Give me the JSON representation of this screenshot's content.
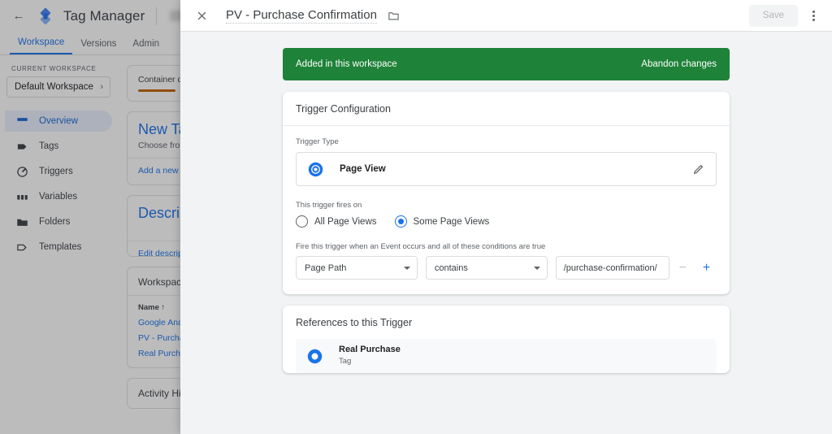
{
  "background": {
    "back_icon": "back-arrow-icon",
    "brand": "Tag Manager",
    "tabs": [
      {
        "label": "Workspace",
        "active": true
      },
      {
        "label": "Versions",
        "active": false
      },
      {
        "label": "Admin",
        "active": false
      }
    ],
    "workspace_section_label": "CURRENT WORKSPACE",
    "workspace_name": "Default Workspace",
    "workspace_chevron": "chevron-right-icon",
    "nav": [
      {
        "label": "Overview",
        "icon": "overview-icon",
        "active": true
      },
      {
        "label": "Tags",
        "icon": "tag-icon",
        "active": false
      },
      {
        "label": "Triggers",
        "icon": "trigger-icon",
        "active": false
      },
      {
        "label": "Variables",
        "icon": "variables-icon",
        "active": false
      },
      {
        "label": "Folders",
        "icon": "folder-icon",
        "active": false
      },
      {
        "label": "Templates",
        "icon": "template-icon",
        "active": false
      }
    ],
    "cards": {
      "quality_title": "Container quality",
      "new_tag_title": "New Tag",
      "new_tag_sub": "Choose from ou",
      "new_tag_link": "Add a new tag",
      "description_title": "Description",
      "description_link": "Edit description",
      "changes_title": "Workspace Ch",
      "changes_col_name": "Name",
      "changes_sort_icon": "sort-ascending-icon",
      "changes_rows": [
        "Google Analytic",
        "PV - Purchase C",
        "Real Purchase"
      ],
      "activity_title": "Activity Histor"
    }
  },
  "dialog": {
    "close_icon": "close-icon",
    "title": "PV - Purchase Confirmation",
    "folder_icon": "folder-icon",
    "save_label": "Save",
    "kebab_icon": "more-options-icon",
    "banner": {
      "message": "Added in this workspace",
      "action": "Abandon changes"
    },
    "trigger_config": {
      "card_title": "Trigger Configuration",
      "type_label": "Trigger Type",
      "type_icon": "page-view-icon",
      "type_name": "Page View",
      "edit_icon": "pencil-icon",
      "fires_on_label": "This trigger fires on",
      "options": [
        {
          "label": "All Page Views",
          "selected": false
        },
        {
          "label": "Some Page Views",
          "selected": true
        }
      ],
      "conditions_label": "Fire this trigger when an Event occurs and all of these conditions are true",
      "condition": {
        "variable": "Page Path",
        "operator": "contains",
        "value": "/purchase-confirmation/",
        "remove_icon": "minus-icon",
        "add_icon": "plus-icon"
      }
    },
    "references": {
      "card_title": "References to this Trigger",
      "items": [
        {
          "name": "Real Purchase",
          "type": "Tag",
          "icon": "tag-circle-icon"
        }
      ]
    }
  },
  "colors": {
    "accent": "#1a73e8",
    "banner_green": "#1e8238",
    "surface": "#ffffff",
    "dialog_bg": "#f1f3f4",
    "quality_bar": "#c26401"
  }
}
